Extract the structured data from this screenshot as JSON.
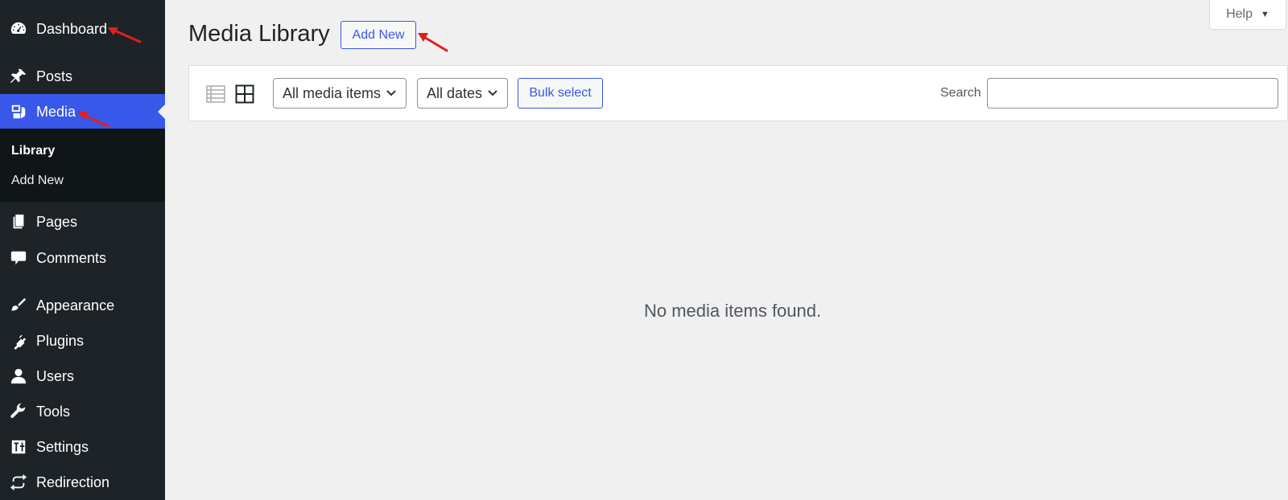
{
  "sidebar": {
    "items": [
      {
        "label": "Dashboard",
        "icon": "dashboard-icon"
      },
      {
        "label": "Posts",
        "icon": "pin-icon"
      },
      {
        "label": "Media",
        "icon": "media-icon",
        "active": true
      },
      {
        "label": "Pages",
        "icon": "pages-icon"
      },
      {
        "label": "Comments",
        "icon": "comment-icon"
      },
      {
        "label": "Appearance",
        "icon": "brush-icon"
      },
      {
        "label": "Plugins",
        "icon": "plugin-icon"
      },
      {
        "label": "Users",
        "icon": "user-icon"
      },
      {
        "label": "Tools",
        "icon": "wrench-icon"
      },
      {
        "label": "Settings",
        "icon": "settings-icon"
      },
      {
        "label": "Redirection",
        "icon": "redirect-icon"
      }
    ],
    "submenu": [
      {
        "label": "Library",
        "current": true
      },
      {
        "label": "Add New"
      }
    ]
  },
  "header": {
    "title": "Media Library",
    "add_new_label": "Add New",
    "help_label": "Help"
  },
  "toolbar": {
    "media_filter": "All media items",
    "date_filter": "All dates",
    "bulk_select_label": "Bulk select",
    "search_label": "Search",
    "search_value": ""
  },
  "main": {
    "empty_message": "No media items found."
  },
  "colors": {
    "sidebar_bg": "#1d2327",
    "accent": "#3858e9",
    "annotation_arrow": "#e01f1f"
  }
}
